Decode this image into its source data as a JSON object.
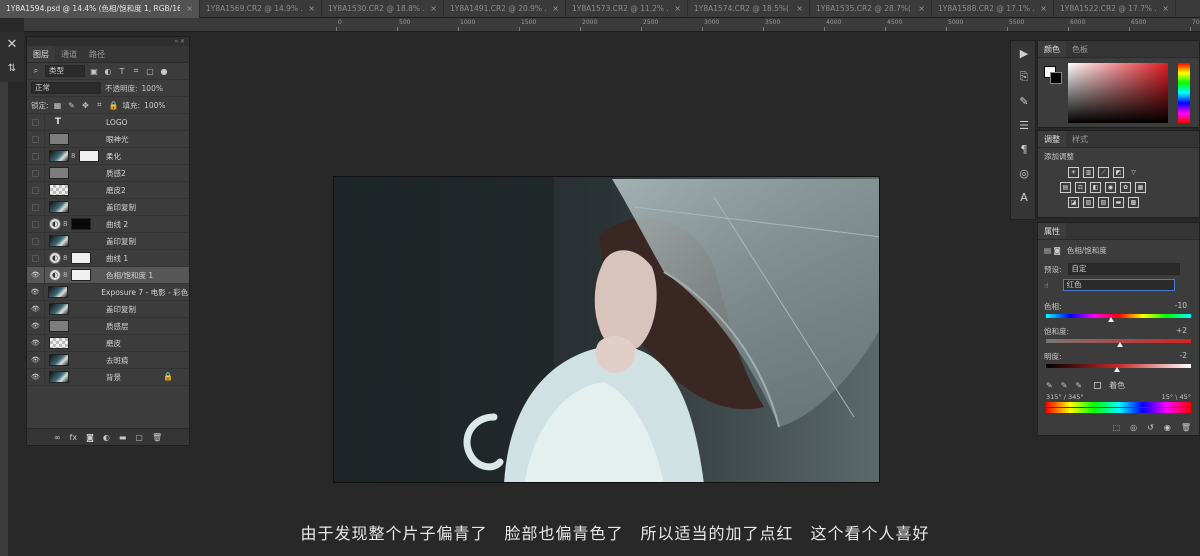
{
  "tabs": [
    {
      "label": "1Y8A1594.psd @ 14.4% (色相/饱和度 1, RGB/16) *",
      "active": true
    },
    {
      "label": "1Y8A1569.CR2 @ 14.9% ...",
      "active": false
    },
    {
      "label": "1Y8A1530.CR2 @ 18.8% ...",
      "active": false
    },
    {
      "label": "1Y8A1491.CR2 @ 20.9% ...",
      "active": false
    },
    {
      "label": "1Y8A1573.CR2 @ 11.2% ...",
      "active": false
    },
    {
      "label": "1Y8A1574.CR2 @ 18.5%(...",
      "active": false
    },
    {
      "label": "1Y8A1535.CR2 @ 28.7%(...",
      "active": false
    },
    {
      "label": "1Y8A1588.CR2 @ 17.1% ...",
      "active": false
    },
    {
      "label": "1Y8A1522.CR2 @ 17.7% ...",
      "active": false
    }
  ],
  "tab_close": "×",
  "ruler_ticks": [
    "0",
    "500",
    "1000",
    "1500",
    "2000",
    "2500",
    "3000",
    "3500",
    "4000",
    "4500",
    "5000",
    "5500",
    "6000",
    "6500",
    "7000",
    "7500",
    "8000",
    "8500"
  ],
  "layers_panel": {
    "tabs": [
      "图层",
      "通道",
      "路径"
    ],
    "filter_kind": "类型",
    "blend_mode": "正常",
    "opacity_label": "不透明度:",
    "opacity_value": "100%",
    "lock_label": "锁定:",
    "fill_label": "填充:",
    "fill_value": "100%",
    "layers": [
      {
        "name": "LOGO",
        "visible": false,
        "thumb": "text",
        "text_glyph": "T"
      },
      {
        "name": "眼神光",
        "visible": false,
        "thumb": "gray"
      },
      {
        "name": "柔化",
        "visible": false,
        "thumb": "img",
        "mask": "white"
      },
      {
        "name": "质感2",
        "visible": false,
        "thumb": "gray"
      },
      {
        "name": "磨皮2",
        "visible": false,
        "thumb": "check"
      },
      {
        "name": "盖印复制",
        "visible": false,
        "thumb": "img"
      },
      {
        "name": "曲线 2",
        "visible": false,
        "thumb": "adj",
        "mask": "black"
      },
      {
        "name": "盖印复制",
        "visible": false,
        "thumb": "img"
      },
      {
        "name": "曲线 1",
        "visible": false,
        "thumb": "adj",
        "mask": "white"
      },
      {
        "name": "色相/饱和度 1",
        "visible": true,
        "thumb": "adj",
        "mask": "white",
        "selected": true
      },
      {
        "name": "Exposure 7 - 电影 - 彩色...",
        "visible": true,
        "thumb": "img"
      },
      {
        "name": "盖印复制",
        "visible": true,
        "thumb": "img"
      },
      {
        "name": "质感层",
        "visible": true,
        "thumb": "gray"
      },
      {
        "name": "磨皮",
        "visible": true,
        "thumb": "check"
      },
      {
        "name": "去斑痕",
        "visible": true,
        "thumb": "img"
      },
      {
        "name": "背景",
        "visible": true,
        "thumb": "img",
        "locked": true
      }
    ],
    "footer_icons": [
      "link-icon",
      "fx-icon",
      "mask-icon",
      "adjustment-icon",
      "folder-icon",
      "new-layer-icon",
      "trash-icon"
    ]
  },
  "color_panel": {
    "tabs": [
      "颜色",
      "色板"
    ]
  },
  "adjust_panel": {
    "tabs": [
      "调整",
      "样式"
    ],
    "add_label": "添加调整"
  },
  "properties_panel": {
    "tab": "属性",
    "title": "色相/饱和度",
    "preset_label": "预设:",
    "preset_value": "自定",
    "channel_value": "红色",
    "hue_label": "色相:",
    "hue_value": "-10",
    "hue_level": -10,
    "sat_label": "饱和度:",
    "sat_value": "+2",
    "sat_level": 2,
    "light_label": "明度:",
    "light_value": "-2",
    "light_level": -2,
    "colorize_label": "着色",
    "range_left": "315° / 345°",
    "range_right": "15° \\ 45°"
  },
  "subtitle": "由于发现整个片子偏青了　脸部也偏青色了　所以适当的加了点红　这个看个人喜好",
  "colors": {
    "bg": "#282828",
    "panel": "#3c3c3c",
    "selected": "#565656",
    "accent": "#4a7bd0"
  }
}
